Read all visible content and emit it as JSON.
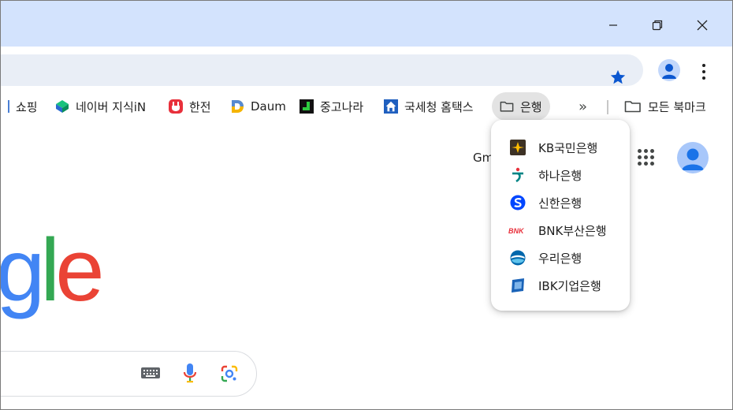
{
  "window": {
    "controls": [
      "minimize",
      "restore",
      "close"
    ]
  },
  "colors": {
    "titlebar": "#d3e3fd",
    "omnibox": "#e9eef6",
    "star": "#0b57d0",
    "bank_underline": "#d32f2f"
  },
  "bookmarks_bar": {
    "items": [
      {
        "label": "쇼핑",
        "icon": "shopping-icon"
      },
      {
        "label": "네이버 지식iN",
        "icon": "naver-kin-icon"
      },
      {
        "label": "한전",
        "icon": "kepco-icon"
      },
      {
        "label": "Daum",
        "icon": "daum-icon"
      },
      {
        "label": "중고나라",
        "icon": "joonggonara-icon"
      },
      {
        "label": "국세청 홈택스",
        "icon": "hometax-icon"
      },
      {
        "label": "은행",
        "icon": "folder-icon"
      }
    ],
    "overflow": "»",
    "all_bookmarks": "모든 북마크"
  },
  "bank_folder_menu": {
    "items": [
      {
        "label": "KB국민은행",
        "icon": "kb-bank-icon"
      },
      {
        "label": "하나은행",
        "icon": "hana-bank-icon"
      },
      {
        "label": "신한은행",
        "icon": "shinhan-bank-icon"
      },
      {
        "label": "BNK부산은행",
        "icon": "bnk-bank-icon"
      },
      {
        "label": "우리은행",
        "icon": "woori-bank-icon"
      },
      {
        "label": "IBK기업은행",
        "icon": "ibk-bank-icon"
      }
    ]
  },
  "google_page": {
    "gmail_link": "Gm",
    "logo_visible": "gle"
  }
}
